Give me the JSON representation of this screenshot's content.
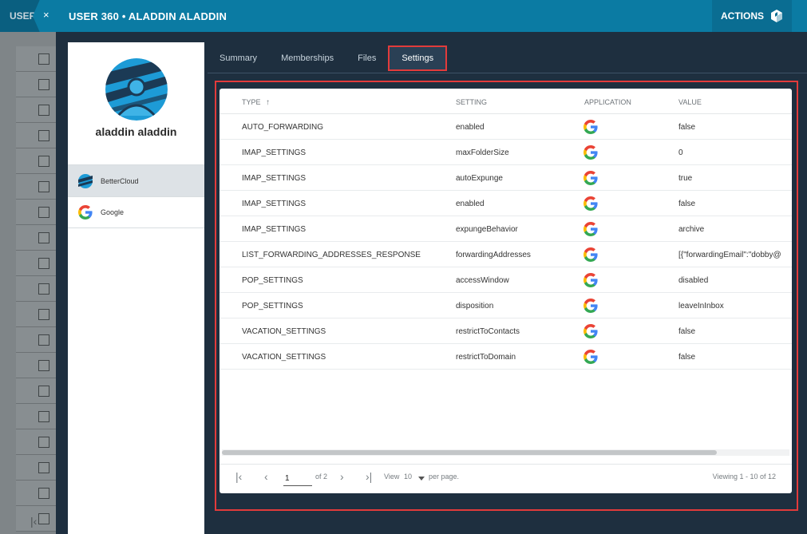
{
  "background": {
    "topbar_text": "USER",
    "row_count": 19
  },
  "header": {
    "title": "USER 360 • ALADDIN ALADDIN",
    "close_glyph": "×",
    "actions_label": "ACTIONS",
    "actions_icon": "cube-icon"
  },
  "profile": {
    "name": "aladdin aladdin",
    "sources": [
      {
        "label": "BetterCloud",
        "icon": "bettercloud-icon",
        "active": true
      },
      {
        "label": "Google",
        "icon": "google-icon",
        "active": false
      }
    ]
  },
  "tabs": [
    {
      "label": "Summary",
      "active": false
    },
    {
      "label": "Memberships",
      "active": false
    },
    {
      "label": "Files",
      "active": false
    },
    {
      "label": "Settings",
      "active": true
    }
  ],
  "table": {
    "columns": {
      "type": "TYPE",
      "sort_glyph": "↑",
      "setting": "SETTING",
      "application": "APPLICATION",
      "value": "VALUE"
    },
    "rows": [
      {
        "type": "AUTO_FORWARDING",
        "setting": "enabled",
        "application": "google-icon",
        "value": "false"
      },
      {
        "type": "IMAP_SETTINGS",
        "setting": "maxFolderSize",
        "application": "google-icon",
        "value": "0"
      },
      {
        "type": "IMAP_SETTINGS",
        "setting": "autoExpunge",
        "application": "google-icon",
        "value": "true"
      },
      {
        "type": "IMAP_SETTINGS",
        "setting": "enabled",
        "application": "google-icon",
        "value": "false"
      },
      {
        "type": "IMAP_SETTINGS",
        "setting": "expungeBehavior",
        "application": "google-icon",
        "value": "archive"
      },
      {
        "type": "LIST_FORWARDING_ADDRESSES_RESPONSE",
        "setting": "forwardingAddresses",
        "application": "google-icon",
        "value": "[{\"forwardingEmail\":\"dobby@"
      },
      {
        "type": "POP_SETTINGS",
        "setting": "accessWindow",
        "application": "google-icon",
        "value": "disabled"
      },
      {
        "type": "POP_SETTINGS",
        "setting": "disposition",
        "application": "google-icon",
        "value": "leaveInInbox"
      },
      {
        "type": "VACATION_SETTINGS",
        "setting": "restrictToContacts",
        "application": "google-icon",
        "value": "false"
      },
      {
        "type": "VACATION_SETTINGS",
        "setting": "restrictToDomain",
        "application": "google-icon",
        "value": "false"
      }
    ],
    "pagination": {
      "first_glyph": "|‹",
      "prev_glyph": "‹",
      "page_value": "1",
      "of_label": "of 2",
      "next_glyph": "›",
      "last_glyph": "›|",
      "view_label": "View",
      "per_page_value": "10",
      "per_page_suffix": "per page.",
      "viewing_text": "Viewing 1 - 10 of 12"
    }
  },
  "colors": {
    "header": "#0b7ba3",
    "accent_red": "#e23b3b",
    "panel": "#1e2f3f"
  }
}
